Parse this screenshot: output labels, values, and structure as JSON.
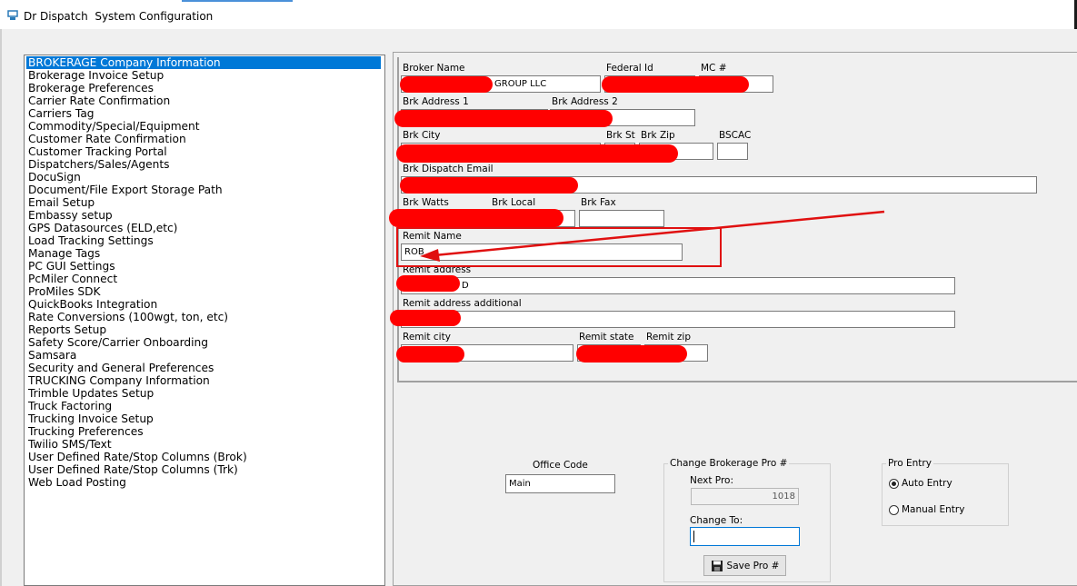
{
  "window": {
    "title": "Dr Dispatch  System Configuration"
  },
  "nav": {
    "items": [
      "BROKERAGE Company Information",
      "Brokerage Invoice Setup",
      "Brokerage Preferences",
      "Carrier Rate Confirmation",
      "Carriers Tag",
      "Commodity/Special/Equipment",
      "Customer Rate Confirmation",
      "Customer Tracking Portal",
      "Dispatchers/Sales/Agents",
      "DocuSign",
      "Document/File Export Storage Path",
      "Email Setup",
      "Embassy setup",
      "GPS Datasources (ELD,etc)",
      "Load Tracking Settings",
      "Manage Tags",
      "PC GUI Settings",
      "PcMiler Connect",
      "ProMiles SDK",
      "QuickBooks Integration",
      "Rate Conversions (100wgt, ton, etc)",
      "Reports Setup",
      "Safety Score/Carrier Onboarding",
      "Samsara",
      "Security and General Preferences",
      "TRUCKING Company Information",
      "Trimble Updates Setup",
      "Truck Factoring",
      "Trucking Invoice Setup",
      "Trucking Preferences",
      "Twilio SMS/Text",
      "User Defined Rate/Stop Columns (Brok)",
      "User Defined Rate/Stop Columns (Trk)",
      "Web Load Posting"
    ],
    "selected_index": 0
  },
  "form": {
    "broker_name_label": "Broker Name",
    "broker_name_value": "GROUP LLC",
    "federal_id_label": "Federal Id",
    "mc_label": "MC #",
    "brk_address1_label": "Brk Address 1",
    "brk_address2_label": "Brk Address 2",
    "brk_city_label": "Brk City",
    "brk_st_label": "Brk St",
    "brk_zip_label": "Brk Zip",
    "bscac_label": "BSCAC",
    "dispatch_email_label": "Brk Dispatch Email",
    "watts_label": "Brk Watts",
    "local_label": "Brk Local",
    "fax_label": "Brk Fax",
    "remit_name_label": "Remit Name",
    "remit_name_value": "ROB",
    "remit_address_label": "Remit address",
    "remit_address_value": "D",
    "remit_address_additional_label": "Remit address additional",
    "remit_city_label": "Remit city",
    "remit_state_label": "Remit state",
    "remit_zip_label": "Remit zip"
  },
  "office": {
    "label": "Office Code",
    "value": "Main"
  },
  "pro": {
    "group_caption": "Change Brokerage Pro #",
    "next_pro_label": "Next Pro:",
    "next_pro_value": "1018",
    "change_to_label": "Change To:",
    "change_to_value": "",
    "save_label": "Save Pro #"
  },
  "pro_entry": {
    "caption": "Pro Entry",
    "auto_label": "Auto Entry",
    "manual_label": "Manual Entry",
    "selected": "auto"
  },
  "colors": {
    "selection": "#0078d7",
    "annotation": "#e01010",
    "redaction": "#ff0000"
  }
}
